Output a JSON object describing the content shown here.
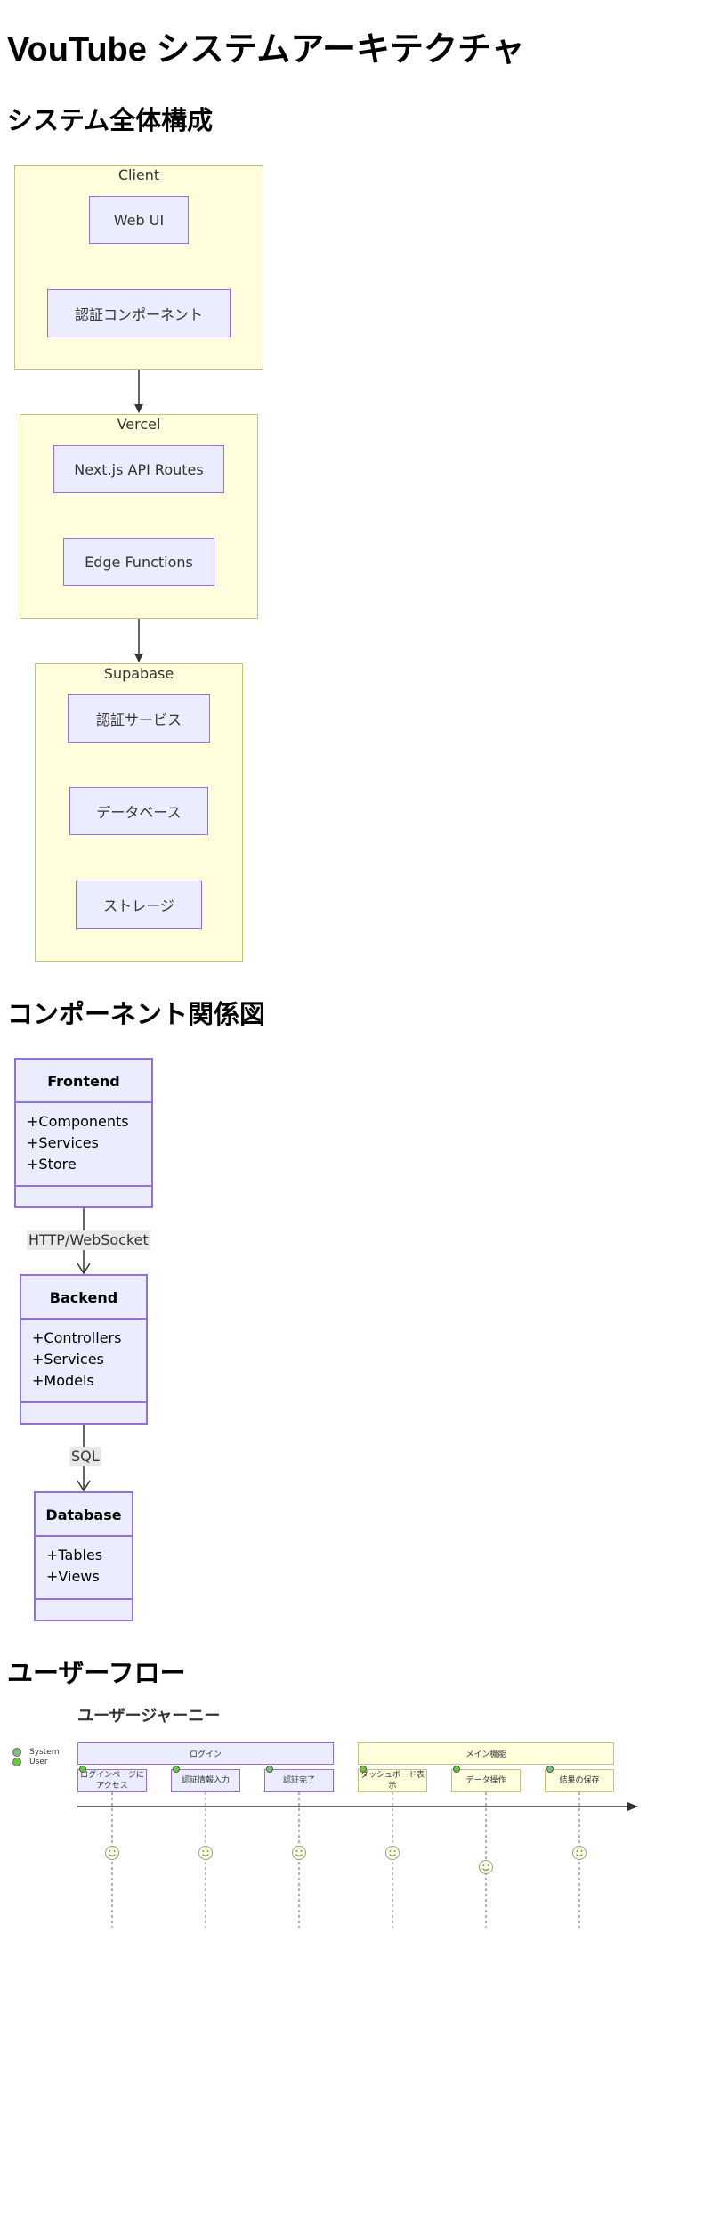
{
  "page_title": "VouTube システムアーキテクチャ",
  "sections": {
    "architecture": "システム全体構成",
    "components": "コンポーネント関係図",
    "userflow": "ユーザーフロー"
  },
  "architecture": {
    "clusters": [
      {
        "title": "Client",
        "nodes": [
          "Web UI",
          "認証コンポーネント"
        ]
      },
      {
        "title": "Vercel",
        "nodes": [
          "Next.js API Routes",
          "Edge Functions"
        ]
      },
      {
        "title": "Supabase",
        "nodes": [
          "認証サービス",
          "データベース",
          "ストレージ"
        ]
      }
    ]
  },
  "components": {
    "classes": [
      {
        "name": "Frontend",
        "members": [
          "+Components",
          "+Services",
          "+Store"
        ]
      },
      {
        "name": "Backend",
        "members": [
          "+Controllers",
          "+Services",
          "+Models"
        ]
      },
      {
        "name": "Database",
        "members": [
          "+Tables",
          "+Views"
        ]
      }
    ],
    "edges": [
      "HTTP/WebSocket",
      "SQL"
    ]
  },
  "journey": {
    "title": "ユーザージャーニー",
    "actors": [
      {
        "name": "System",
        "color": "#7fbf7f"
      },
      {
        "name": "User",
        "color": "#66cc33"
      }
    ],
    "sections": [
      {
        "name": "ログイン",
        "color": "#ececff"
      },
      {
        "name": "メイン機能",
        "color": "#ffffde"
      }
    ],
    "tasks": [
      {
        "label": "ログインページにアクセス",
        "section": 0,
        "score": 5
      },
      {
        "label": "認証情報入力",
        "section": 0,
        "score": 5
      },
      {
        "label": "認証完了",
        "section": 0,
        "score": 5
      },
      {
        "label": "ダッシュボード表示",
        "section": 1,
        "score": 5
      },
      {
        "label": "データ操作",
        "section": 1,
        "score": 4
      },
      {
        "label": "結果の保存",
        "section": 1,
        "score": 5
      }
    ]
  }
}
